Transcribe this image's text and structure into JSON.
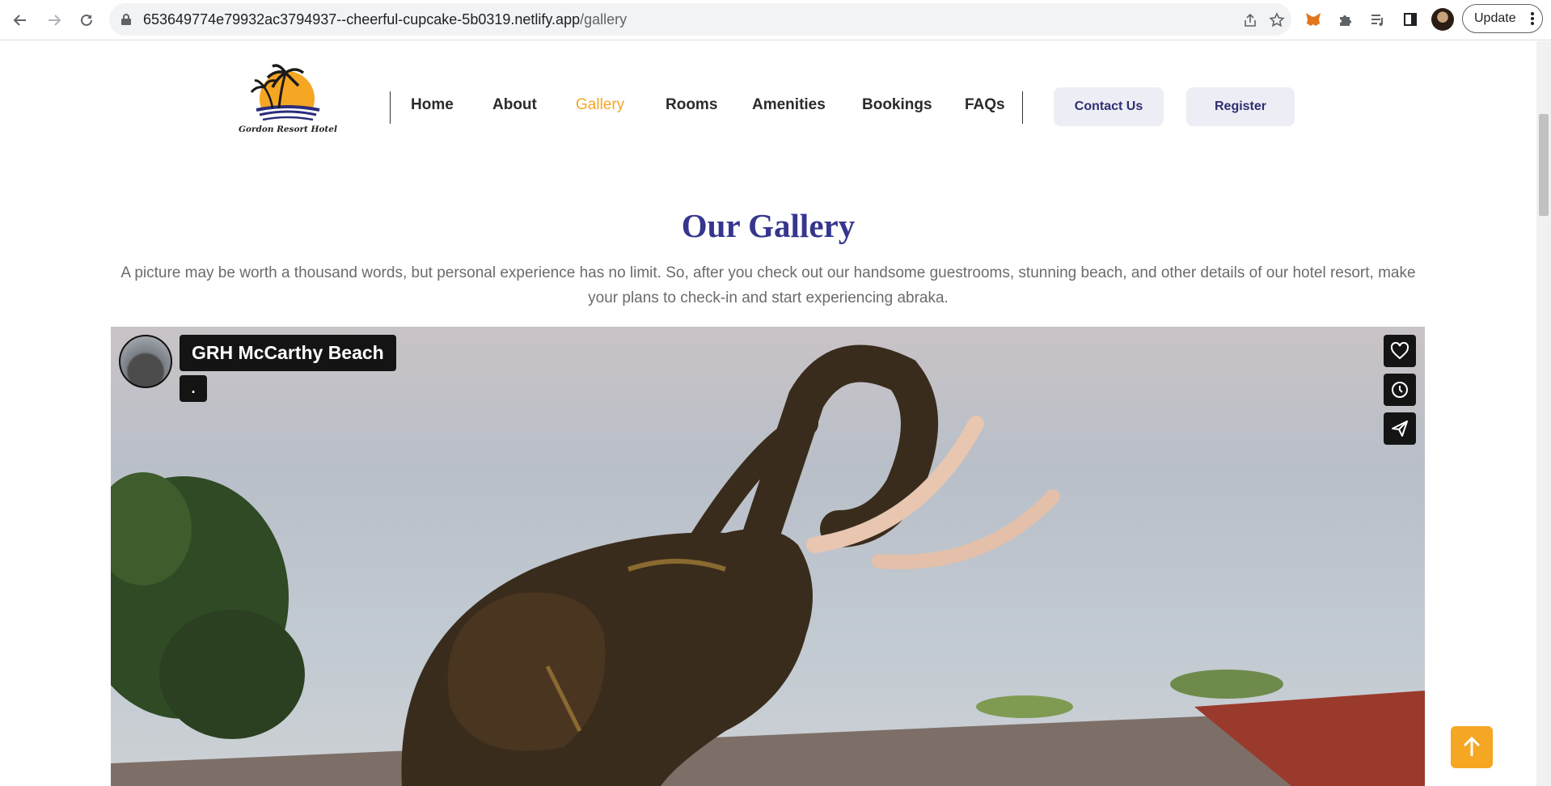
{
  "browser": {
    "url_host": "653649774e79932ac3794937--cheerful-cupcake-5b0319.netlify.app",
    "url_path": "/gallery",
    "update_label": "Update"
  },
  "site": {
    "logo_text": "Gordon Resort Hotel",
    "nav": [
      {
        "label": "Home"
      },
      {
        "label": "About"
      },
      {
        "label": "Gallery"
      },
      {
        "label": "Rooms"
      },
      {
        "label": "Amenities"
      },
      {
        "label": "Bookings"
      },
      {
        "label": "FAQs"
      }
    ],
    "active_nav": "Gallery",
    "contact_label": "Contact Us",
    "register_label": "Register"
  },
  "gallery": {
    "title": "Our Gallery",
    "intro": "A picture may be worth a thousand words, but personal experience has no limit. So, after you check out our handsome guestrooms, stunning beach, and other details of our hotel resort, make your plans to check-in and start experiencing abraka."
  },
  "video": {
    "title": "GRH McCarthy Beach",
    "subtitle": "."
  },
  "colors": {
    "accent": "#f5a623",
    "brand_blue": "#36368f",
    "pill_bg": "#ededf5"
  }
}
